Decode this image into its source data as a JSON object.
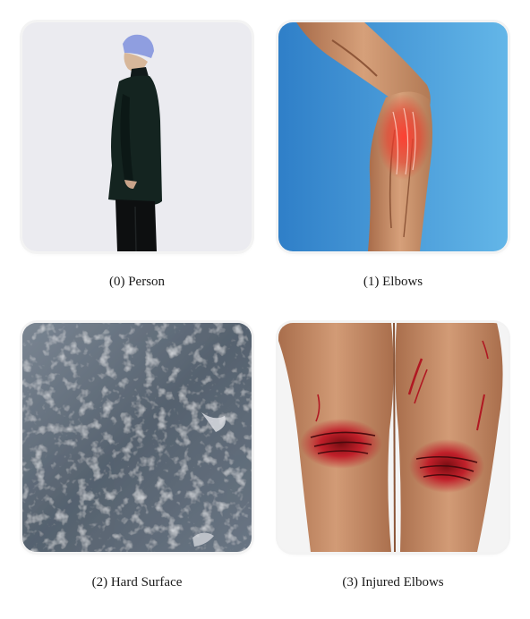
{
  "panels": [
    {
      "caption": "(0) Person",
      "subject": "person"
    },
    {
      "caption": "(1) Elbows",
      "subject": "elbow"
    },
    {
      "caption": "(2) Hard Surface",
      "subject": "hard-surface"
    },
    {
      "caption": "(3) Injured Elbows",
      "subject": "injured-elbows"
    }
  ],
  "colors": {
    "card_border": "#f3f3f3",
    "caption_text": "#1a1a1a",
    "person_bg": "#ebebf0",
    "elbow_bg": "#3a93d6",
    "surface": "#5d6977",
    "skin": "#c98c66",
    "wound": "#c0202a"
  }
}
